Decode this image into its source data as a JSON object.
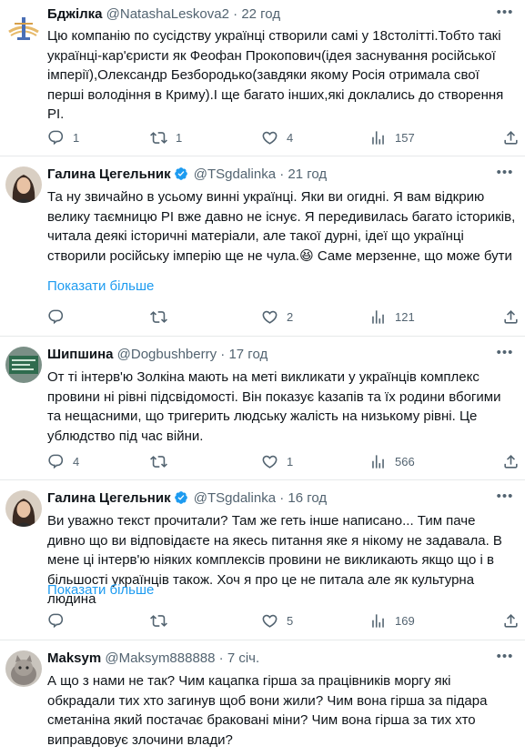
{
  "tweets": [
    {
      "name": "Бджілка",
      "handle": "@NatashaLeskova2",
      "sep": "·",
      "time": "22 год",
      "verified": false,
      "text": "Цю компанію по сусідству українці створили самі у 18столітті.Тобто такі українці-кар'єристи як Феофан Прокопович(ідея заснування російської імперії),Олександр Безбородько(завдяки якому Росія отримала свої перші володіння в Криму).І ще багато інших,які доклались до створення РІ.",
      "show_more": "",
      "replies": "1",
      "reposts": "1",
      "likes": "4",
      "views": "157"
    },
    {
      "name": "Галина Цегельник",
      "handle": "@TSgdalinka",
      "sep": "·",
      "time": "21 год",
      "verified": true,
      "text": "Та ну звичайно в усьому винні українці. Яки ви огидні. Я вам відкрию велику таємницю РІ вже давно не існує. Я передивилась багато істориків, читала деякі історичні матеріали, але такої дурні, ідеї що українці створили російську імперію ще не чула.😆  Саме мерзенне, що може бути",
      "show_more": "Показати більше",
      "replies": "",
      "reposts": "",
      "likes": "2",
      "views": "121"
    },
    {
      "name": "Шипшина",
      "handle": "@Dogbushberry",
      "sep": "·",
      "time": "17 год",
      "verified": false,
      "text": "От ті інтерв'ю Золкіна мають на меті викликати у українців комплекс провини ні рівні підсвідомості. Він показує kазапів та їх родини вбогими та нещасними, що тригерить людську жалість на низькому рівні. Це ублюдство під час війни.",
      "show_more": "",
      "replies": "4",
      "reposts": "",
      "likes": "1",
      "views": "566"
    },
    {
      "name": "Галина Цегельник",
      "handle": "@TSgdalinka",
      "sep": "·",
      "time": "16 год",
      "verified": true,
      "text": "Ви уважно текст прочитали? Там же геть інше написано... Тим паче дивно що ви відповідаєте на якесь питання яке я нікому не задавала. В мене ці інтерв'ю ніяких комплексів провини не викликають якщо що і в більшості українців також. Хоч я про це не питала але як культурна людина",
      "show_more": "Показати більше",
      "replies": "",
      "reposts": "",
      "likes": "5",
      "views": "169"
    },
    {
      "name": "Maksym",
      "handle": "@Maksym888888",
      "sep": "·",
      "time": "7 січ.",
      "verified": false,
      "text": "А що з нами не так? Чим кацапка гірша за працівників моргу які обкрадали тих хто загинув щоб вони жили? Чим вона гірша за підара сметаніна який постачає браковані міни? Чим вона гірша за тих хто виправдовує злочини влади?",
      "show_more": "",
      "replies": "",
      "reposts": "",
      "likes": "",
      "views": ""
    }
  ],
  "icons": {
    "reply": "reply-icon",
    "repost": "repost-icon",
    "like": "like-icon",
    "views": "views-icon",
    "share": "share-icon",
    "more": "more-icon",
    "verified": "verified-badge-icon"
  },
  "colors": {
    "text": "#0f1419",
    "muted": "#536471",
    "link": "#1d9bf0",
    "verified": "#1d9bf0",
    "divider": "#e6e9ea"
  }
}
